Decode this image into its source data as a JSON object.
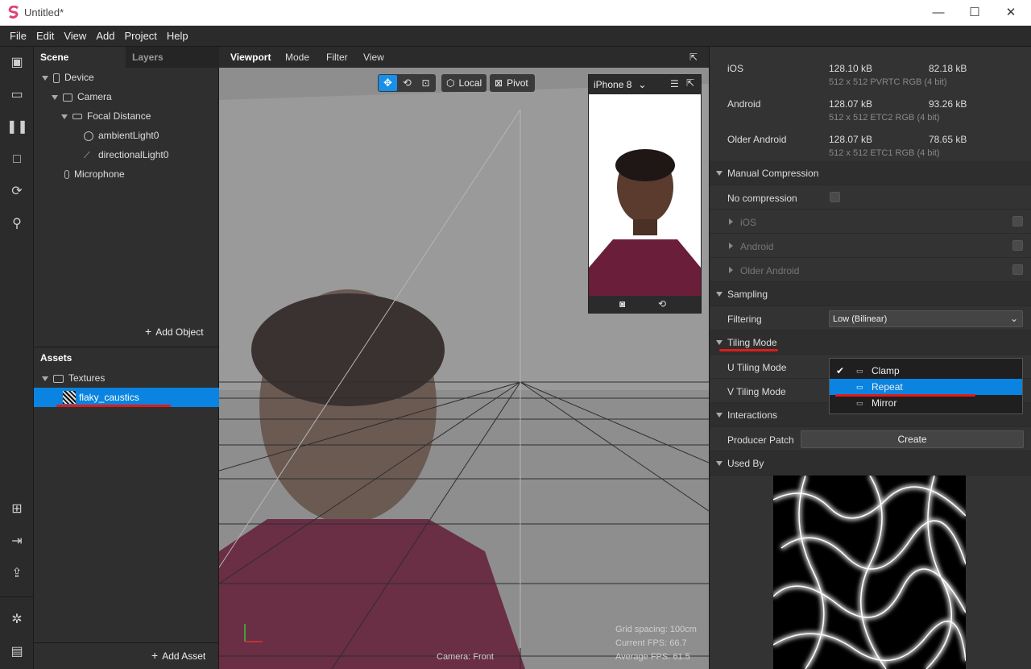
{
  "window": {
    "title": "Untitled*",
    "minimize": "—",
    "maximize": "☐",
    "close": "✕"
  },
  "menu": [
    "File",
    "Edit",
    "View",
    "Add",
    "Project",
    "Help"
  ],
  "scene_panel": {
    "tabs": [
      "Scene",
      "Layers"
    ],
    "tree": [
      "Device",
      "Camera",
      "Focal Distance",
      "ambientLight0",
      "directionalLight0",
      "Microphone"
    ],
    "add_object": "Add Object"
  },
  "assets_panel": {
    "title": "Assets",
    "folder": "Textures",
    "selected_asset": "flaky_caustics",
    "add_asset": "Add Asset"
  },
  "viewport": {
    "tabs": [
      "Viewport",
      "Mode",
      "Filter",
      "View"
    ],
    "local_label": "Local",
    "pivot_label": "Pivot",
    "device": "iPhone 8",
    "grid_spacing": "Grid spacing: 100cm",
    "current_fps": "Current FPS:  66.7",
    "average_fps": "Average FPS:  61.5",
    "camera": "Camera: Front"
  },
  "inspector": {
    "platforms": [
      {
        "name": "iOS",
        "size1": "128.10 kB",
        "size2": "82.18 kB",
        "format": "512 x 512 PVRTC RGB (4 bit)"
      },
      {
        "name": "Android",
        "size1": "128.07 kB",
        "size2": "93.26 kB",
        "format": "512 x 512 ETC2 RGB (4 bit)"
      },
      {
        "name": "Older Android",
        "size1": "128.07 kB",
        "size2": "78.65 kB",
        "format": "512 x 512 ETC1 RGB (4 bit)"
      }
    ],
    "manual_compression": "Manual Compression",
    "no_compression": "No compression",
    "compression_items": [
      "iOS",
      "Android",
      "Older Android"
    ],
    "sampling": "Sampling",
    "filtering_label": "Filtering",
    "filtering_value": "Low (Bilinear)",
    "tiling_mode": "Tiling Mode",
    "u_tiling": "U Tiling Mode",
    "v_tiling": "V Tiling Mode",
    "tiling_options": [
      "Clamp",
      "Repeat",
      "Mirror"
    ],
    "interactions": "Interactions",
    "producer_patch": "Producer Patch",
    "create": "Create",
    "used_by": "Used By"
  }
}
